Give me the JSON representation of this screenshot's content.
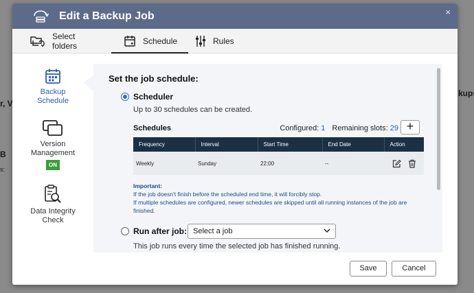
{
  "background": {
    "text_left_1": "r, Vi",
    "text_left_2": "B",
    "text_left_3": "s:",
    "text_right_1": "kups"
  },
  "dialog": {
    "title": "Edit a Backup Job",
    "close_glyph": "×"
  },
  "tabs": [
    {
      "label": "Select folders",
      "icon": "folder-sync-icon"
    },
    {
      "label": "Schedule",
      "icon": "calendar-icon"
    },
    {
      "label": "Rules",
      "icon": "sliders-icon"
    }
  ],
  "sidenav": {
    "items": [
      {
        "label_line1": "Backup",
        "label_line2": "Schedule",
        "icon": "calendar-icon"
      },
      {
        "label_line1": "Version",
        "label_line2": "Management",
        "badge": "ON",
        "icon": "stacked-windows-icon"
      },
      {
        "label_line1": "Data Integrity",
        "label_line2": "Check",
        "icon": "clipboard-search-icon"
      }
    ]
  },
  "panel": {
    "title": "Set the job schedule:",
    "scheduler_label": "Scheduler",
    "scheduler_desc": "Up to 30 schedules can be created.",
    "schedules_heading": "Schedules",
    "configured_label": "Configured:",
    "configured_value": "1",
    "remaining_label": "Remaining slots:",
    "remaining_value": "29",
    "add_label": "+",
    "table": {
      "headers": [
        "Frequency",
        "Interval",
        "Start Time",
        "End Date",
        "Action"
      ],
      "rows": [
        {
          "frequency": "Weekly",
          "interval": "Sunday",
          "start_time": "22:00",
          "end_date": "--"
        }
      ]
    },
    "important_title": "Important:",
    "important_line1": "If the job doesn't finish before the scheduled end time, it will forcibly stop.",
    "important_line2": "If multiple schedules are configured, newer schedules are skipped until all running instances of the job are finished.",
    "run_after_label": "Run after job:",
    "select_job_value": "Select a job",
    "run_after_desc": "This job runs every time the selected job has finished running."
  },
  "footer": {
    "save_label": "Save",
    "cancel_label": "Cancel"
  },
  "colors": {
    "titlebar": "#5d6b8b",
    "accent": "#2d6fd1",
    "table_header": "#1b2f45",
    "on_badge": "#3c9d3c",
    "important_text": "#1d4a8a"
  }
}
